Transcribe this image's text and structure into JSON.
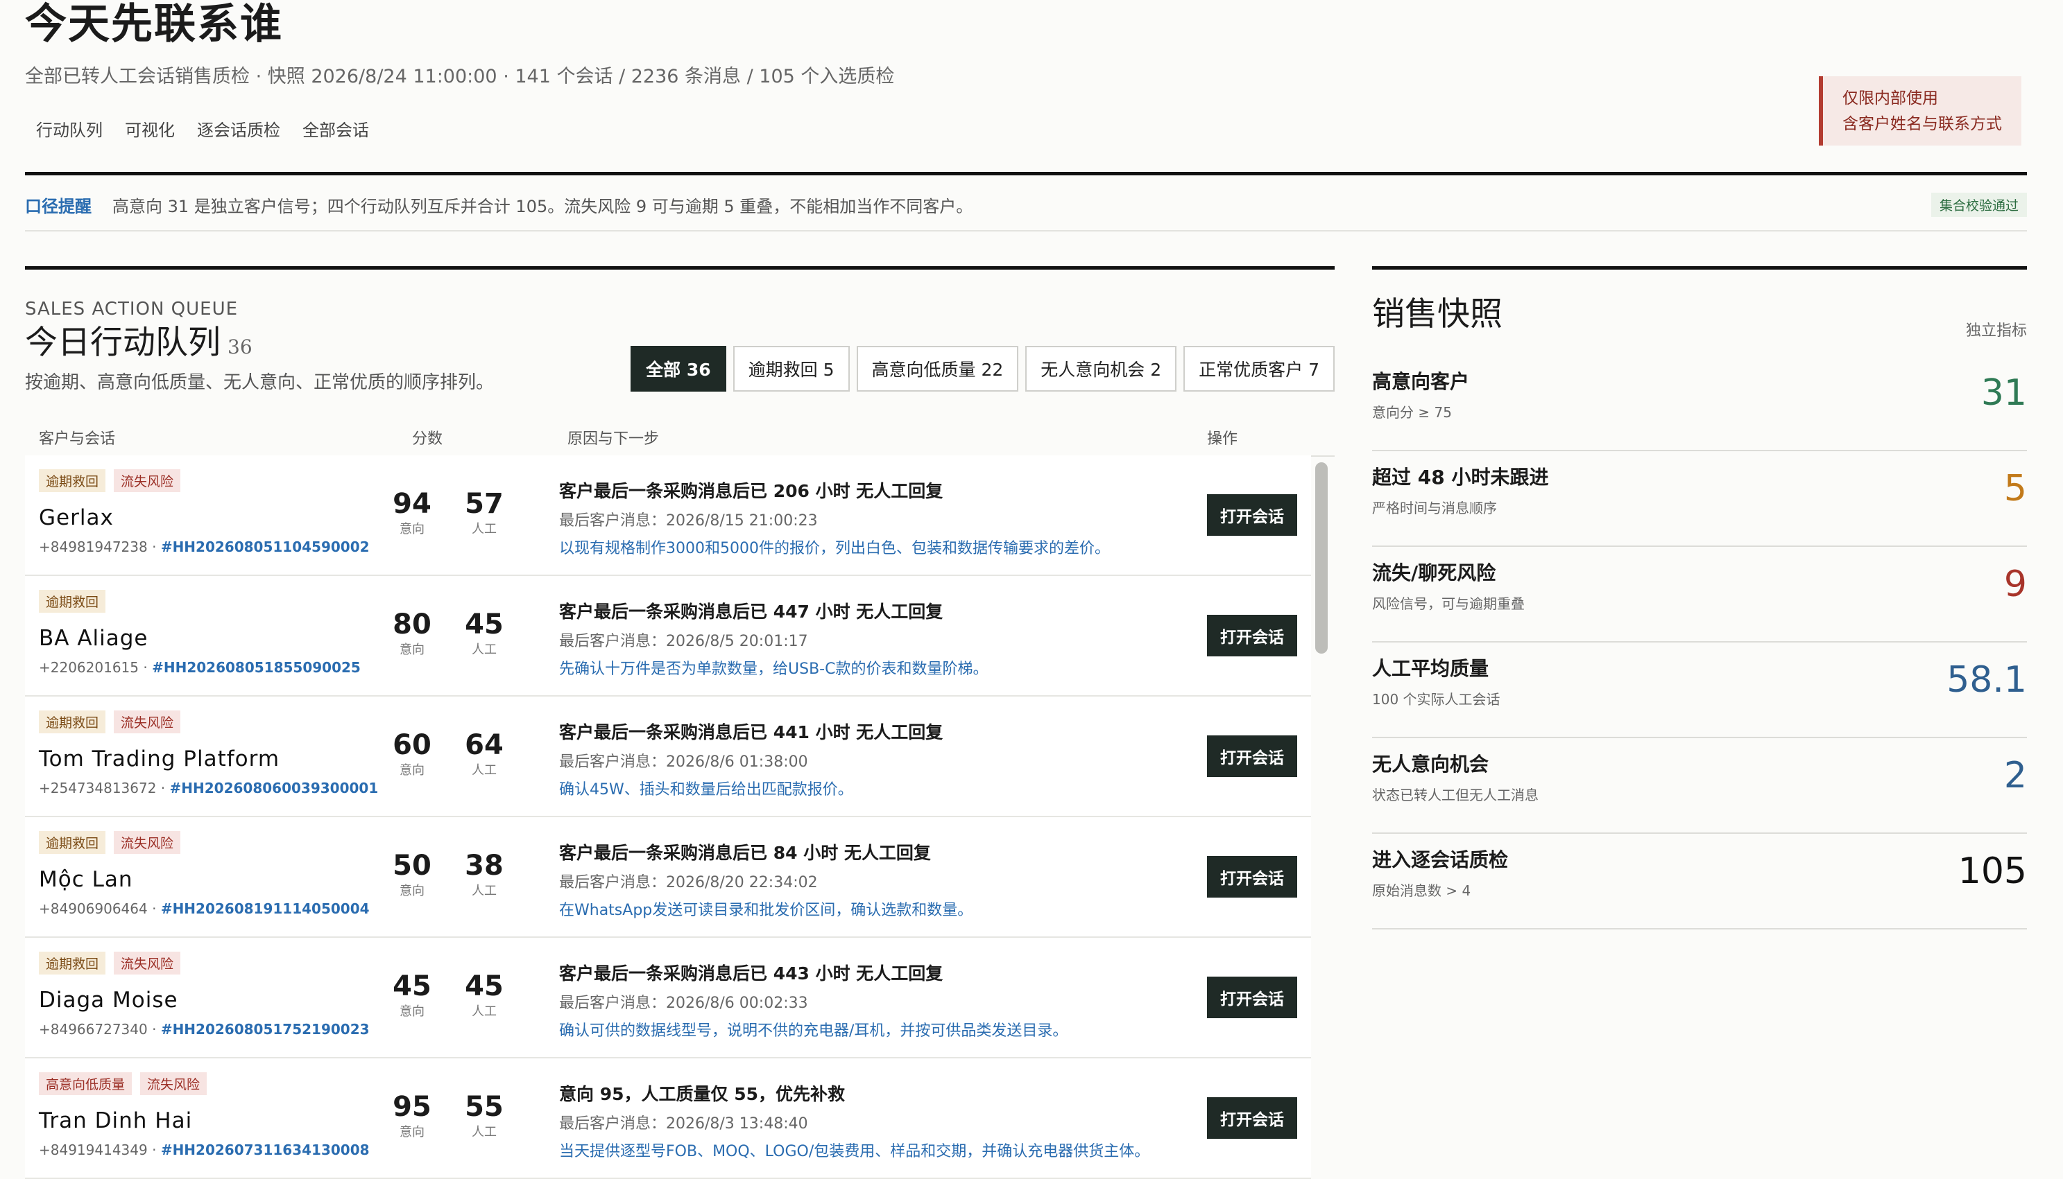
{
  "header": {
    "title": "今天先联系谁",
    "subtitle": "全部已转人工会话销售质检 · 快照 2026/8/24 11:00:00 · 141 个会话 / 2236 条消息 / 105 个入选质检",
    "nav": [
      "行动队列",
      "可视化",
      "逐会话质检",
      "全部会话"
    ],
    "notice_line1": "仅限内部使用",
    "notice_line2": "含客户姓名与联系方式"
  },
  "caliber": {
    "label": "口径提醒",
    "text": "高意向 31 是独立客户信号；四个行动队列互斥并合计 105。流失风险 9 可与逾期 5 重叠，不能相加当作不同客户。",
    "validation": "集合校验通过"
  },
  "queue": {
    "eyebrow": "SALES ACTION QUEUE",
    "title": "今日行动队列",
    "count": "36",
    "desc": "按逾期、高意向低质量、无人意向、正常优质的顺序排列。",
    "filters": [
      "全部 36",
      "逾期救回 5",
      "高意向低质量 22",
      "无人意向机会 2",
      "正常优质客户 7"
    ],
    "columns": [
      "客户与会话",
      "分数",
      "原因与下一步",
      "操作"
    ],
    "intent_label": "意向",
    "human_label": "人工",
    "open_label": "打开会话",
    "rows": [
      {
        "tags": [
          {
            "text": "逾期救回",
            "type": "overdue"
          },
          {
            "text": "流失风险",
            "type": "risk"
          }
        ],
        "name": "Gerlax",
        "phone": "+84981947238",
        "sep": " · ",
        "id": "#HH202608051104590002",
        "intent": "94",
        "human": "57",
        "reason": "客户最后一条采购消息后已 206 小时 无人工回复",
        "last": "最后客户消息：2026/8/15 21:00:23",
        "next": "以现有规格制作3000和5000件的报价，列出白色、包装和数据传输要求的差价。"
      },
      {
        "tags": [
          {
            "text": "逾期救回",
            "type": "overdue"
          }
        ],
        "name": "BA Aliage",
        "phone": "+2206201615",
        "sep": " · ",
        "id": "#HH202608051855090025",
        "intent": "80",
        "human": "45",
        "reason": "客户最后一条采购消息后已 447 小时 无人工回复",
        "last": "最后客户消息：2026/8/5 20:01:17",
        "next": "先确认十万件是否为单款数量，给USB-C款的价表和数量阶梯。"
      },
      {
        "tags": [
          {
            "text": "逾期救回",
            "type": "overdue"
          },
          {
            "text": "流失风险",
            "type": "risk"
          }
        ],
        "name": "Tom Trading Platform",
        "phone": "+254734813672",
        "sep": " · ",
        "id": "#HH202608060039300001",
        "intent": "60",
        "human": "64",
        "reason": "客户最后一条采购消息后已 441 小时 无人工回复",
        "last": "最后客户消息：2026/8/6 01:38:00",
        "next": "确认45W、插头和数量后给出匹配款报价。"
      },
      {
        "tags": [
          {
            "text": "逾期救回",
            "type": "overdue"
          },
          {
            "text": "流失风险",
            "type": "risk"
          }
        ],
        "name": "Mộc Lan",
        "phone": "+84906906464",
        "sep": " · ",
        "id": "#HH202608191114050004",
        "intent": "50",
        "human": "38",
        "reason": "客户最后一条采购消息后已 84 小时 无人工回复",
        "last": "最后客户消息：2026/8/20 22:34:02",
        "next": "在WhatsApp发送可读目录和批发价区间，确认选款和数量。"
      },
      {
        "tags": [
          {
            "text": "逾期救回",
            "type": "overdue"
          },
          {
            "text": "流失风险",
            "type": "risk"
          }
        ],
        "name": "Diaga Moise",
        "phone": "+84966727340",
        "sep": " · ",
        "id": "#HH202608051752190023",
        "intent": "45",
        "human": "45",
        "reason": "客户最后一条采购消息后已 443 小时 无人工回复",
        "last": "最后客户消息：2026/8/6 00:02:33",
        "next": "确认可供的数据线型号，说明不供的充电器/耳机，并按可供品类发送目录。"
      },
      {
        "tags": [
          {
            "text": "高意向低质量",
            "type": "lowq"
          },
          {
            "text": "流失风险",
            "type": "risk"
          }
        ],
        "name": "Tran Dinh Hai",
        "phone": "+84919414349",
        "sep": " · ",
        "id": "#HH202607311634130008",
        "intent": "95",
        "human": "55",
        "reason": "意向 95，人工质量仅 55，优先补救",
        "last": "最后客户消息：2026/8/3 13:48:40",
        "next": "当天提供逐型号FOB、MOQ、LOGO/包装费用、样品和交期，并确认充电器供货主体。"
      }
    ]
  },
  "snapshot": {
    "title": "销售快照",
    "subtitle": "独立指标",
    "metrics": [
      {
        "label": "高意向客户",
        "hint": "意向分 ≥ 75",
        "value": "31",
        "color": "#2f7a55"
      },
      {
        "label": "超过 48 小时未跟进",
        "hint": "严格时间与消息顺序",
        "value": "5",
        "color": "#c27a1a"
      },
      {
        "label": "流失/聊死风险",
        "hint": "风险信号，可与逾期重叠",
        "value": "9",
        "color": "#a8342a"
      },
      {
        "label": "人工平均质量",
        "hint": "100 个实际人工会话",
        "value": "58.1",
        "color": "#2f5f8f"
      },
      {
        "label": "无人意向机会",
        "hint": "状态已转人工但无人工消息",
        "value": "2",
        "color": "#2f5f8f"
      },
      {
        "label": "进入逐会话质检",
        "hint": "原始消息数 > 4",
        "value": "105",
        "color": "#111111"
      }
    ]
  }
}
